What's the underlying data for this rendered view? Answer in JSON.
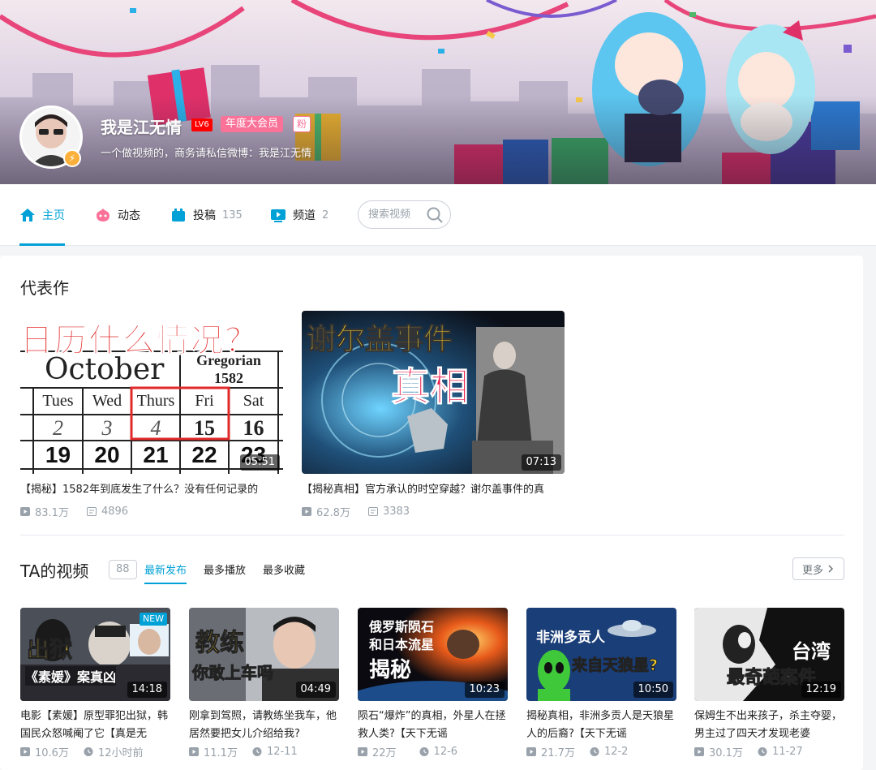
{
  "profile": {
    "name": "我是江无情",
    "level": "LV6",
    "vip_label": "年度大会员",
    "fan_badge": "粉",
    "sign": "一个做视频的，商务请私信微博：我是江无情"
  },
  "nav": {
    "items": [
      {
        "label": "主页",
        "count": "",
        "icon": "home-icon"
      },
      {
        "label": "动态",
        "count": "",
        "icon": "dynamic-icon"
      },
      {
        "label": "投稿",
        "count": "135",
        "icon": "upload-icon"
      },
      {
        "label": "频道",
        "count": "2",
        "icon": "channel-icon"
      }
    ],
    "search_placeholder": "搜索视频"
  },
  "representative": {
    "title": "代表作",
    "videos": [
      {
        "title": "【揭秘】1582年到底发生了什么？没有任何记录的",
        "duration": "05:51",
        "views": "83.1万",
        "danmaku": "4896",
        "overlay": "日历什么情况？",
        "cal_month": "October",
        "cal_header": "Gregorian 1582",
        "cal_days": [
          "Tues",
          "Wed",
          "Thurs",
          "Fri",
          "Sat"
        ],
        "cal_row1": [
          "2",
          "3",
          "4",
          "15",
          "16"
        ],
        "cal_row2": [
          "19",
          "20",
          "21",
          "22",
          "23"
        ]
      },
      {
        "title": "【揭秘真相】官方承认的时空穿越？谢尔盖事件的真",
        "duration": "07:13",
        "views": "62.8万",
        "danmaku": "3383",
        "overlay1": "谢尔盖事件",
        "overlay2": "真相"
      }
    ]
  },
  "videos_section": {
    "title": "TA的视频",
    "count": "88",
    "tabs": [
      "最新发布",
      "最多播放",
      "最多收藏"
    ],
    "more": "更多"
  },
  "video_list": [
    {
      "title": "电影【素媛】原型罪犯出狱，韩国民众怒喊阉了它【真是无",
      "duration": "14:18",
      "views": "10.6万",
      "time": "12小时前",
      "badge": "NEW",
      "ov1": "出狱",
      "ov2": "《素媛》案真凶"
    },
    {
      "title": "刚拿到驾照，请教练坐我车，他居然要把女儿介绍给我?",
      "duration": "04:49",
      "views": "11.1万",
      "time": "12-11",
      "ov1": "教练",
      "ov2": "你敢上车吗"
    },
    {
      "title": "陨石“爆炸”的真相，外星人在拯救人类?【天下无谣",
      "duration": "10:23",
      "views": "22万",
      "time": "12-6",
      "ov1": "俄罗斯陨石",
      "ov2": "和日本流星",
      "ov3": "揭秘"
    },
    {
      "title": "揭秘真相，非洲多贡人是天狼星人的后裔?【天下无谣",
      "duration": "10:50",
      "views": "21.7万",
      "time": "12-2",
      "ov1": "非洲多贡人",
      "ov2": "来自天狼星?"
    },
    {
      "title": "保姆生不出来孩子，杀主夺婴，男主过了四天才发现老婆",
      "duration": "12:19",
      "views": "30.1万",
      "time": "11-27",
      "ov1": "台湾",
      "ov2": "最奇葩案件"
    }
  ],
  "colors": {
    "accent": "#00a1d6",
    "pink": "#fb7299",
    "gray": "#99a2aa"
  }
}
